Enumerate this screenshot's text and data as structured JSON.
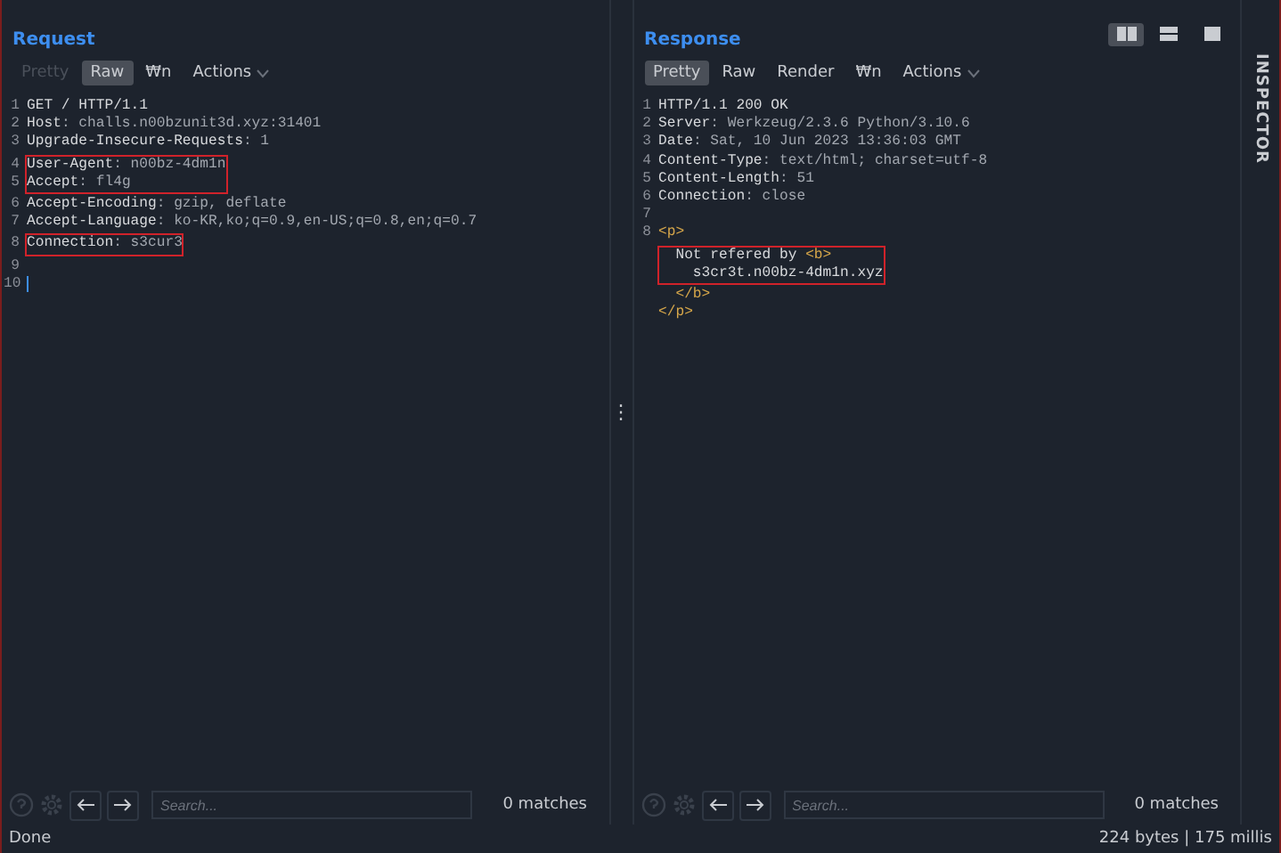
{
  "layout_buttons": [
    {
      "kind": "split",
      "selected": true
    },
    {
      "kind": "stack",
      "selected": false
    },
    {
      "kind": "single",
      "selected": false
    }
  ],
  "request": {
    "title": "Request",
    "tabs": [
      {
        "label": "Pretty",
        "selected": false,
        "disabled": true
      },
      {
        "label": "Raw",
        "selected": true,
        "disabled": false
      },
      {
        "label": "₩n",
        "selected": false,
        "disabled": false
      },
      {
        "label": "Actions",
        "selected": false,
        "disabled": false,
        "dropdown": true
      }
    ],
    "blocks": [
      {
        "boxed": false,
        "lines": [
          {
            "num": "1",
            "parts": [
              {
                "kind": "plain",
                "text": "GET / HTTP/1.1"
              }
            ]
          },
          {
            "num": "2",
            "parts": [
              {
                "kind": "key",
                "text": "Host"
              },
              {
                "kind": "value",
                "text": ": challs.n00bzunit3d.xyz:31401"
              }
            ]
          },
          {
            "num": "3",
            "parts": [
              {
                "kind": "key",
                "text": "Upgrade-Insecure-Requests"
              },
              {
                "kind": "value",
                "text": ": 1"
              }
            ]
          }
        ]
      },
      {
        "boxed": true,
        "lines": [
          {
            "num": "4",
            "parts": [
              {
                "kind": "key",
                "text": "User-Agent"
              },
              {
                "kind": "value",
                "text": ": n00bz-4dm1n"
              }
            ]
          },
          {
            "num": "5",
            "parts": [
              {
                "kind": "key",
                "text": "Accept"
              },
              {
                "kind": "value",
                "text": ": fl4g"
              }
            ]
          }
        ]
      },
      {
        "boxed": false,
        "lines": [
          {
            "num": "6",
            "parts": [
              {
                "kind": "key",
                "text": "Accept-Encoding"
              },
              {
                "kind": "value",
                "text": ": gzip, deflate"
              }
            ]
          },
          {
            "num": "7",
            "parts": [
              {
                "kind": "key",
                "text": "Accept-Language"
              },
              {
                "kind": "value",
                "text": ": ko-KR,ko;q=0.9,en-US;q=0.8,en;q=0.7"
              }
            ]
          }
        ]
      },
      {
        "boxed": true,
        "lines": [
          {
            "num": "8",
            "parts": [
              {
                "kind": "key",
                "text": "Connection"
              },
              {
                "kind": "value",
                "text": ": s3cur3"
              }
            ]
          }
        ]
      },
      {
        "boxed": false,
        "lines": [
          {
            "num": "9"
          },
          {
            "num": "10",
            "cursor": true
          }
        ]
      }
    ],
    "search": {
      "placeholder": "Search...",
      "matches": "0 matches"
    }
  },
  "response": {
    "title": "Response",
    "tabs": [
      {
        "label": "Pretty",
        "selected": true,
        "disabled": false
      },
      {
        "label": "Raw",
        "selected": false,
        "disabled": false
      },
      {
        "label": "Render",
        "selected": false,
        "disabled": false
      },
      {
        "label": "₩n",
        "selected": false,
        "disabled": false
      },
      {
        "label": "Actions",
        "selected": false,
        "disabled": false,
        "dropdown": true
      }
    ],
    "blocks": [
      {
        "boxed": false,
        "lines": [
          {
            "num": "1",
            "parts": [
              {
                "kind": "plain",
                "text": "HTTP/1.1 200 OK"
              }
            ]
          },
          {
            "num": "2",
            "parts": [
              {
                "kind": "key",
                "text": "Server"
              },
              {
                "kind": "value",
                "text": ": Werkzeug/2.3.6 Python/3.10.6"
              }
            ]
          },
          {
            "num": "3",
            "parts": [
              {
                "kind": "key",
                "text": "Date"
              },
              {
                "kind": "value",
                "text": ": Sat, 10 Jun 2023 13:36:03 GMT"
              }
            ]
          },
          {
            "num": "4",
            "parts": [
              {
                "kind": "key",
                "text": "Content-Type"
              },
              {
                "kind": "value",
                "text": ": text/html; charset=utf-8"
              }
            ]
          },
          {
            "num": "5",
            "parts": [
              {
                "kind": "key",
                "text": "Content-Length"
              },
              {
                "kind": "value",
                "text": ": 51"
              }
            ]
          },
          {
            "num": "6",
            "parts": [
              {
                "kind": "key",
                "text": "Connection"
              },
              {
                "kind": "value",
                "text": ": close"
              }
            ]
          },
          {
            "num": "7"
          },
          {
            "num": "8",
            "parts": [
              {
                "kind": "tag",
                "text": "<p>"
              }
            ]
          }
        ]
      },
      {
        "boxed": true,
        "lines": [
          {
            "parts": [
              {
                "kind": "plain",
                "text": "  Not refered by "
              },
              {
                "kind": "tag",
                "text": "<b>"
              }
            ]
          },
          {
            "parts": [
              {
                "kind": "plain",
                "text": "    s3cr3t.n00bz-4dm1n.xyz"
              }
            ]
          }
        ]
      },
      {
        "boxed": false,
        "lines": [
          {
            "parts": [
              {
                "kind": "tag",
                "text": "  </b>"
              }
            ]
          },
          {
            "parts": [
              {
                "kind": "tag",
                "text": "</p>"
              }
            ]
          }
        ]
      }
    ],
    "search": {
      "placeholder": "Search...",
      "matches": "0 matches"
    }
  },
  "splitter": {
    "handle": "⋮"
  },
  "inspector": {
    "label": "INSPECTOR"
  },
  "status_bar": {
    "left": "Done",
    "right": "224 bytes | 175 millis"
  }
}
